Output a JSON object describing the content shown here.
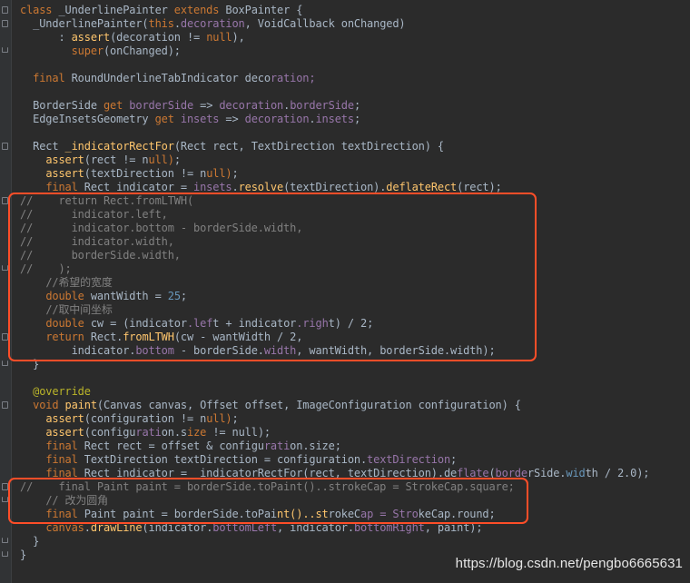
{
  "editor": {
    "lines": [
      "class _UnderlinePainter extends BoxPainter {",
      "  _UnderlinePainter(this.decoration, VoidCallback onChanged)",
      "      : assert(decoration != null),",
      "        super(onChanged);",
      "",
      "  final RoundUnderlineTabIndicator decoration;",
      "",
      "  BorderSide get borderSide => decoration.borderSide;",
      "  EdgeInsetsGeometry get insets => decoration.insets;",
      "",
      "  Rect _indicatorRectFor(Rect rect, TextDirection textDirection) {",
      "    assert(rect != null);",
      "    assert(textDirection != null);",
      "    final Rect indicator = insets.resolve(textDirection).deflateRect(rect);",
      "//    return Rect.fromLTWH(",
      "//      indicator.left,",
      "//      indicator.bottom - borderSide.width,",
      "//      indicator.width,",
      "//      borderSide.width,",
      "//    );",
      "    //希望的宽度",
      "    double wantWidth = 25;",
      "    //取中间坐标",
      "    double cw = (indicator.left + indicator.right) / 2;",
      "    return Rect.fromLTWH(cw - wantWidth / 2,",
      "        indicator.bottom - borderSide.width, wantWidth, borderSide.width);",
      "  }",
      "",
      "  @override",
      "  void paint(Canvas canvas, Offset offset, ImageConfiguration configuration) {",
      "    assert(configuration != null);",
      "    assert(configuration.size != null);",
      "    final Rect rect = offset & configuration.size;",
      "    final TextDirection textDirection = configuration.textDirection;",
      "    final Rect indicator = _indicatorRectFor(rect, textDirection).deflate(borderSide.width / 2.0);",
      "//    final Paint paint = borderSide.toPaint()..strokeCap = StrokeCap.square;",
      "    // 改为圆角",
      "    final Paint paint = borderSide.toPaint()..strokeCap = StrokeCap.round;",
      "    canvas.drawLine(indicator.bottomLeft, indicator.bottomRight, paint);",
      "  }",
      "}"
    ]
  },
  "watermark": "https://blog.csdn.net/pengbo6665631",
  "colors": {
    "background": "#2b2b2b",
    "text": "#a9b7c6",
    "keyword": "#cc7832",
    "function": "#ffc66d",
    "field": "#9876aa",
    "number": "#6897bb",
    "comment": "#808080",
    "annotation": "#bbb529",
    "highlight_box": "#ff4e28"
  }
}
